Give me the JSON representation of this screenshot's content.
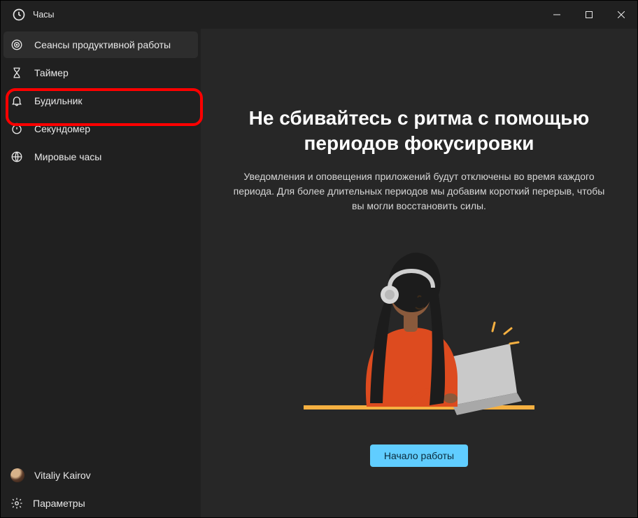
{
  "app": {
    "title": "Часы"
  },
  "sidebar": {
    "items": [
      {
        "label": "Сеансы продуктивной работы",
        "active": true
      },
      {
        "label": "Таймер",
        "active": false
      },
      {
        "label": "Будильник",
        "active": false
      },
      {
        "label": "Секундомер",
        "active": false
      },
      {
        "label": "Мировые часы",
        "active": false
      }
    ],
    "user_name": "Vitaliy Kairov",
    "settings_label": "Параметры"
  },
  "main": {
    "title": "Не сбивайтесь с ритма с помощью периодов фокусировки",
    "description": "Уведомления и оповещения приложений будут отключены во время каждого периода. Для более длительных периодов мы добавим короткий перерыв, чтобы вы могли восстановить силы.",
    "cta_label": "Начало работы"
  }
}
